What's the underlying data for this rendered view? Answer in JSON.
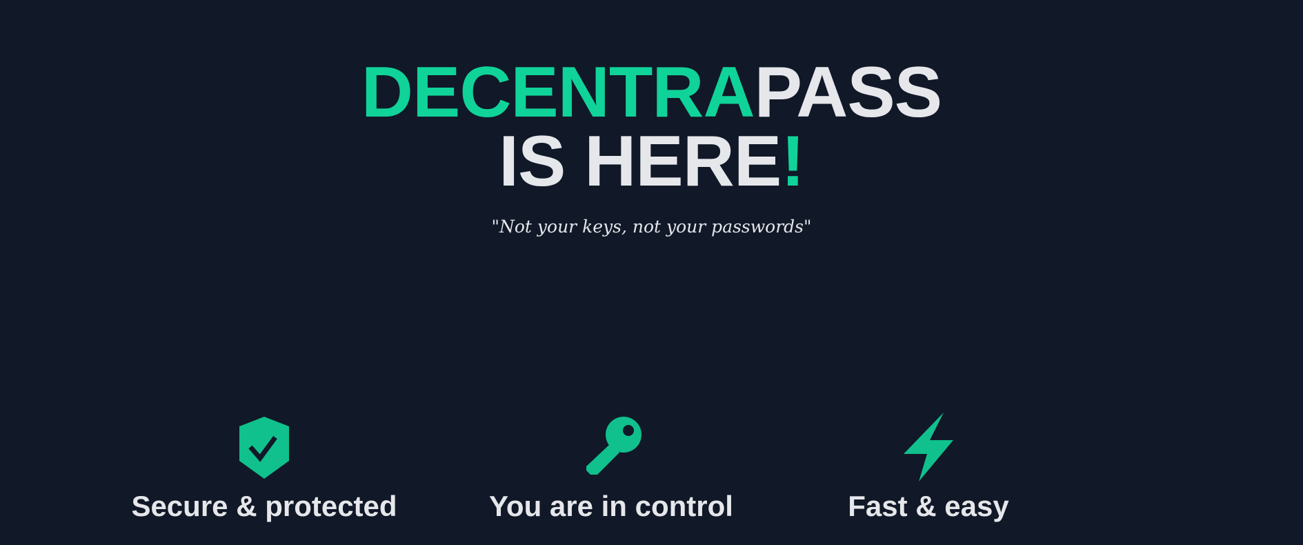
{
  "hero": {
    "title_accent": "DECENTRA",
    "title_rest": "PASS",
    "line2_main": "IS HERE",
    "line2_accent": "!",
    "tagline": "\"Not your keys, not your passwords\""
  },
  "features": [
    {
      "icon": "shield-check-icon",
      "label": "Secure & protected"
    },
    {
      "icon": "key-icon",
      "label": "You are in control"
    },
    {
      "icon": "lightning-bolt-icon",
      "label": "Fast & easy"
    }
  ],
  "colors": {
    "background": "#111827",
    "accent": "#10d39a",
    "text": "#e5e7eb"
  }
}
